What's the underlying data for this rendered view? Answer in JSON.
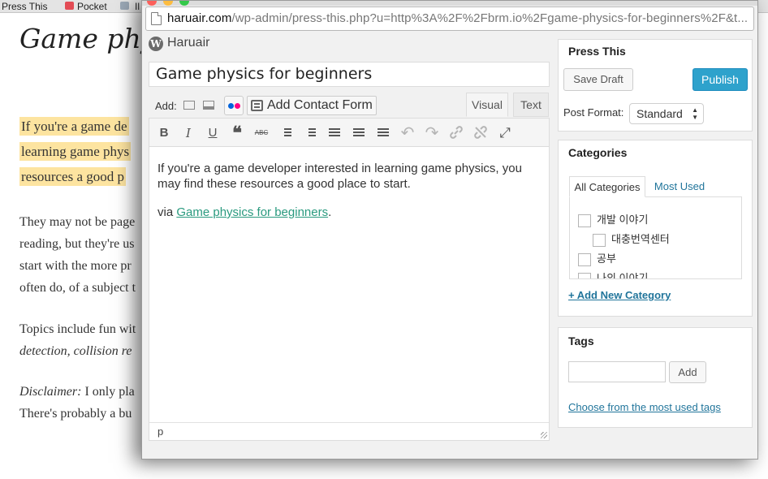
{
  "bookmarks": [
    "Press This",
    "Pocket",
    "Il"
  ],
  "background_article": {
    "title": "Game phy",
    "highlight_lines": [
      "If you're a game de",
      "learning game phys",
      "resources a good p"
    ],
    "para1": [
      "They may not be page",
      "reading, but they're us",
      "start with the more pr",
      "often do, of a subject t"
    ],
    "para2_line1": "Topics include fun wit",
    "para2_line2": "detection, collision re",
    "disclaimer_label": "Disclaimer:",
    "disclaimer_text": " I only pla",
    "para3_line2": "There's probably a bu"
  },
  "window": {
    "url_domain": "haruair.com",
    "url_rest": "/wp-admin/press-this.php?u=http%3A%2F%2Fbrm.io%2Fgame-physics-for-beginners%2F&t..."
  },
  "site": {
    "name": "Haruair",
    "logo": "W"
  },
  "post": {
    "title": "Game physics for beginners",
    "body": "If you're a game developer interested in learning game physics, you may find these resources a good place to start.",
    "via_prefix": "via ",
    "via_link": "Game physics for beginners",
    "via_suffix": ".",
    "path": "p"
  },
  "media": {
    "add_label": "Add:",
    "contact_form_label": "Add Contact Form",
    "flickr_colors": [
      "#0063dc",
      "#ff0084"
    ]
  },
  "editor_tabs": {
    "visual": "Visual",
    "text": "Text"
  },
  "toolbar": {
    "bold": "B",
    "italic": "I",
    "underline": "U",
    "blockquote": "❝",
    "strikethrough": "ABC",
    "undo": "↶",
    "redo": "↷",
    "fullscreen": "⤢"
  },
  "publish_box": {
    "title": "Press This",
    "save_draft": "Save Draft",
    "publish": "Publish",
    "post_format_label": "Post Format:",
    "post_format_value": "Standard"
  },
  "categories_box": {
    "title": "Categories",
    "tab_all": "All Categories",
    "tab_used": "Most Used",
    "items": [
      "개발 이야기",
      "대충번역센터",
      "공부",
      "나의 이야기"
    ],
    "add_new": "+ Add New Category"
  },
  "tags_box": {
    "title": "Tags",
    "add": "Add",
    "choose": "Choose from the most used tags"
  },
  "colors": {
    "accent": "#2ea2cc",
    "link": "#21759b",
    "highlight": "#fde4a0"
  }
}
